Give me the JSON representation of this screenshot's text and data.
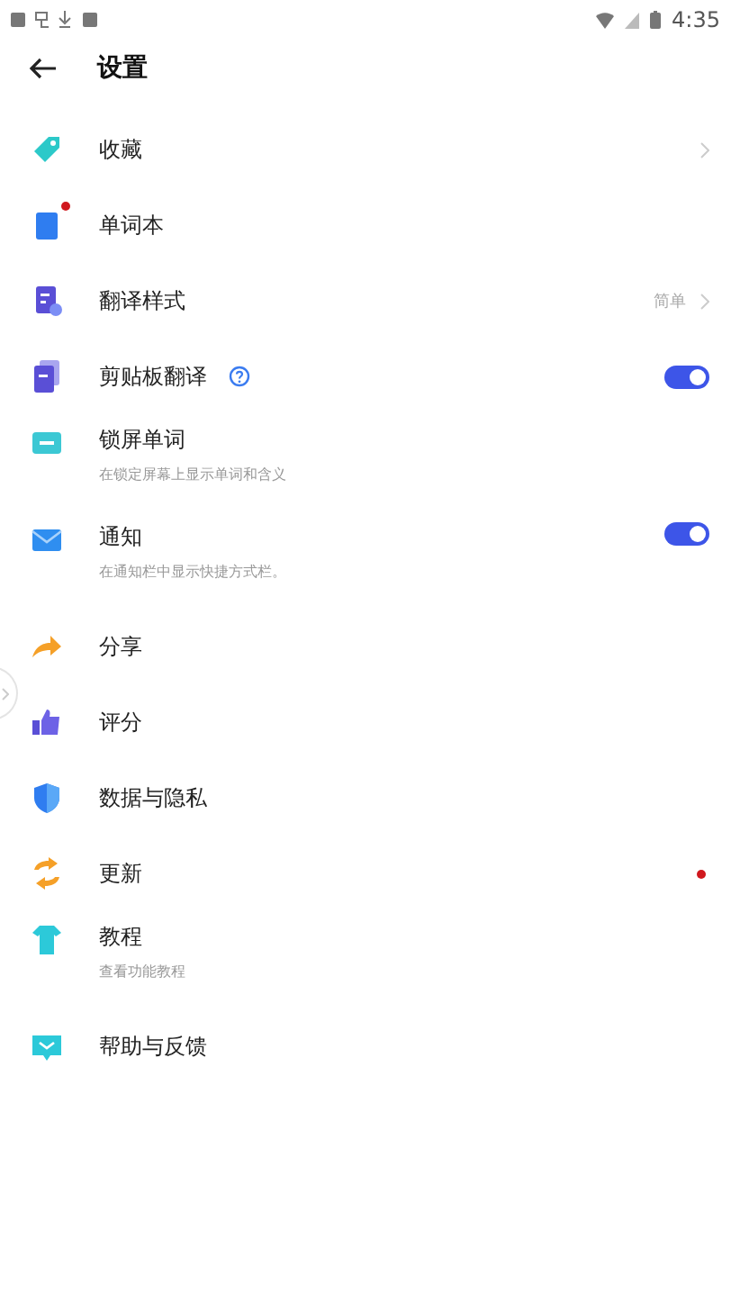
{
  "status_bar": {
    "time": "4:35"
  },
  "header": {
    "title": "设置"
  },
  "items": [
    {
      "label": "收藏",
      "kind": "chevron"
    },
    {
      "label": "单词本",
      "kind": "plain",
      "badge": true
    },
    {
      "label": "翻译样式",
      "kind": "chevron",
      "value": "简单"
    },
    {
      "label": "剪贴板翻译",
      "kind": "toggle",
      "on": true,
      "help": true
    },
    {
      "label": "锁屏单词",
      "kind": "plain",
      "subtitle": "在锁定屏幕上显示单词和含义"
    },
    {
      "label": "通知",
      "kind": "toggle",
      "on": true,
      "subtitle": "在通知栏中显示快捷方式栏。"
    },
    {
      "label": "分享",
      "kind": "plain"
    },
    {
      "label": "评分",
      "kind": "plain"
    },
    {
      "label": "数据与隐私",
      "kind": "plain"
    },
    {
      "label": "更新",
      "kind": "plain",
      "dot": true
    },
    {
      "label": "教程",
      "kind": "plain",
      "subtitle": "查看功能教程"
    },
    {
      "label": "帮助与反馈",
      "kind": "plain"
    }
  ]
}
